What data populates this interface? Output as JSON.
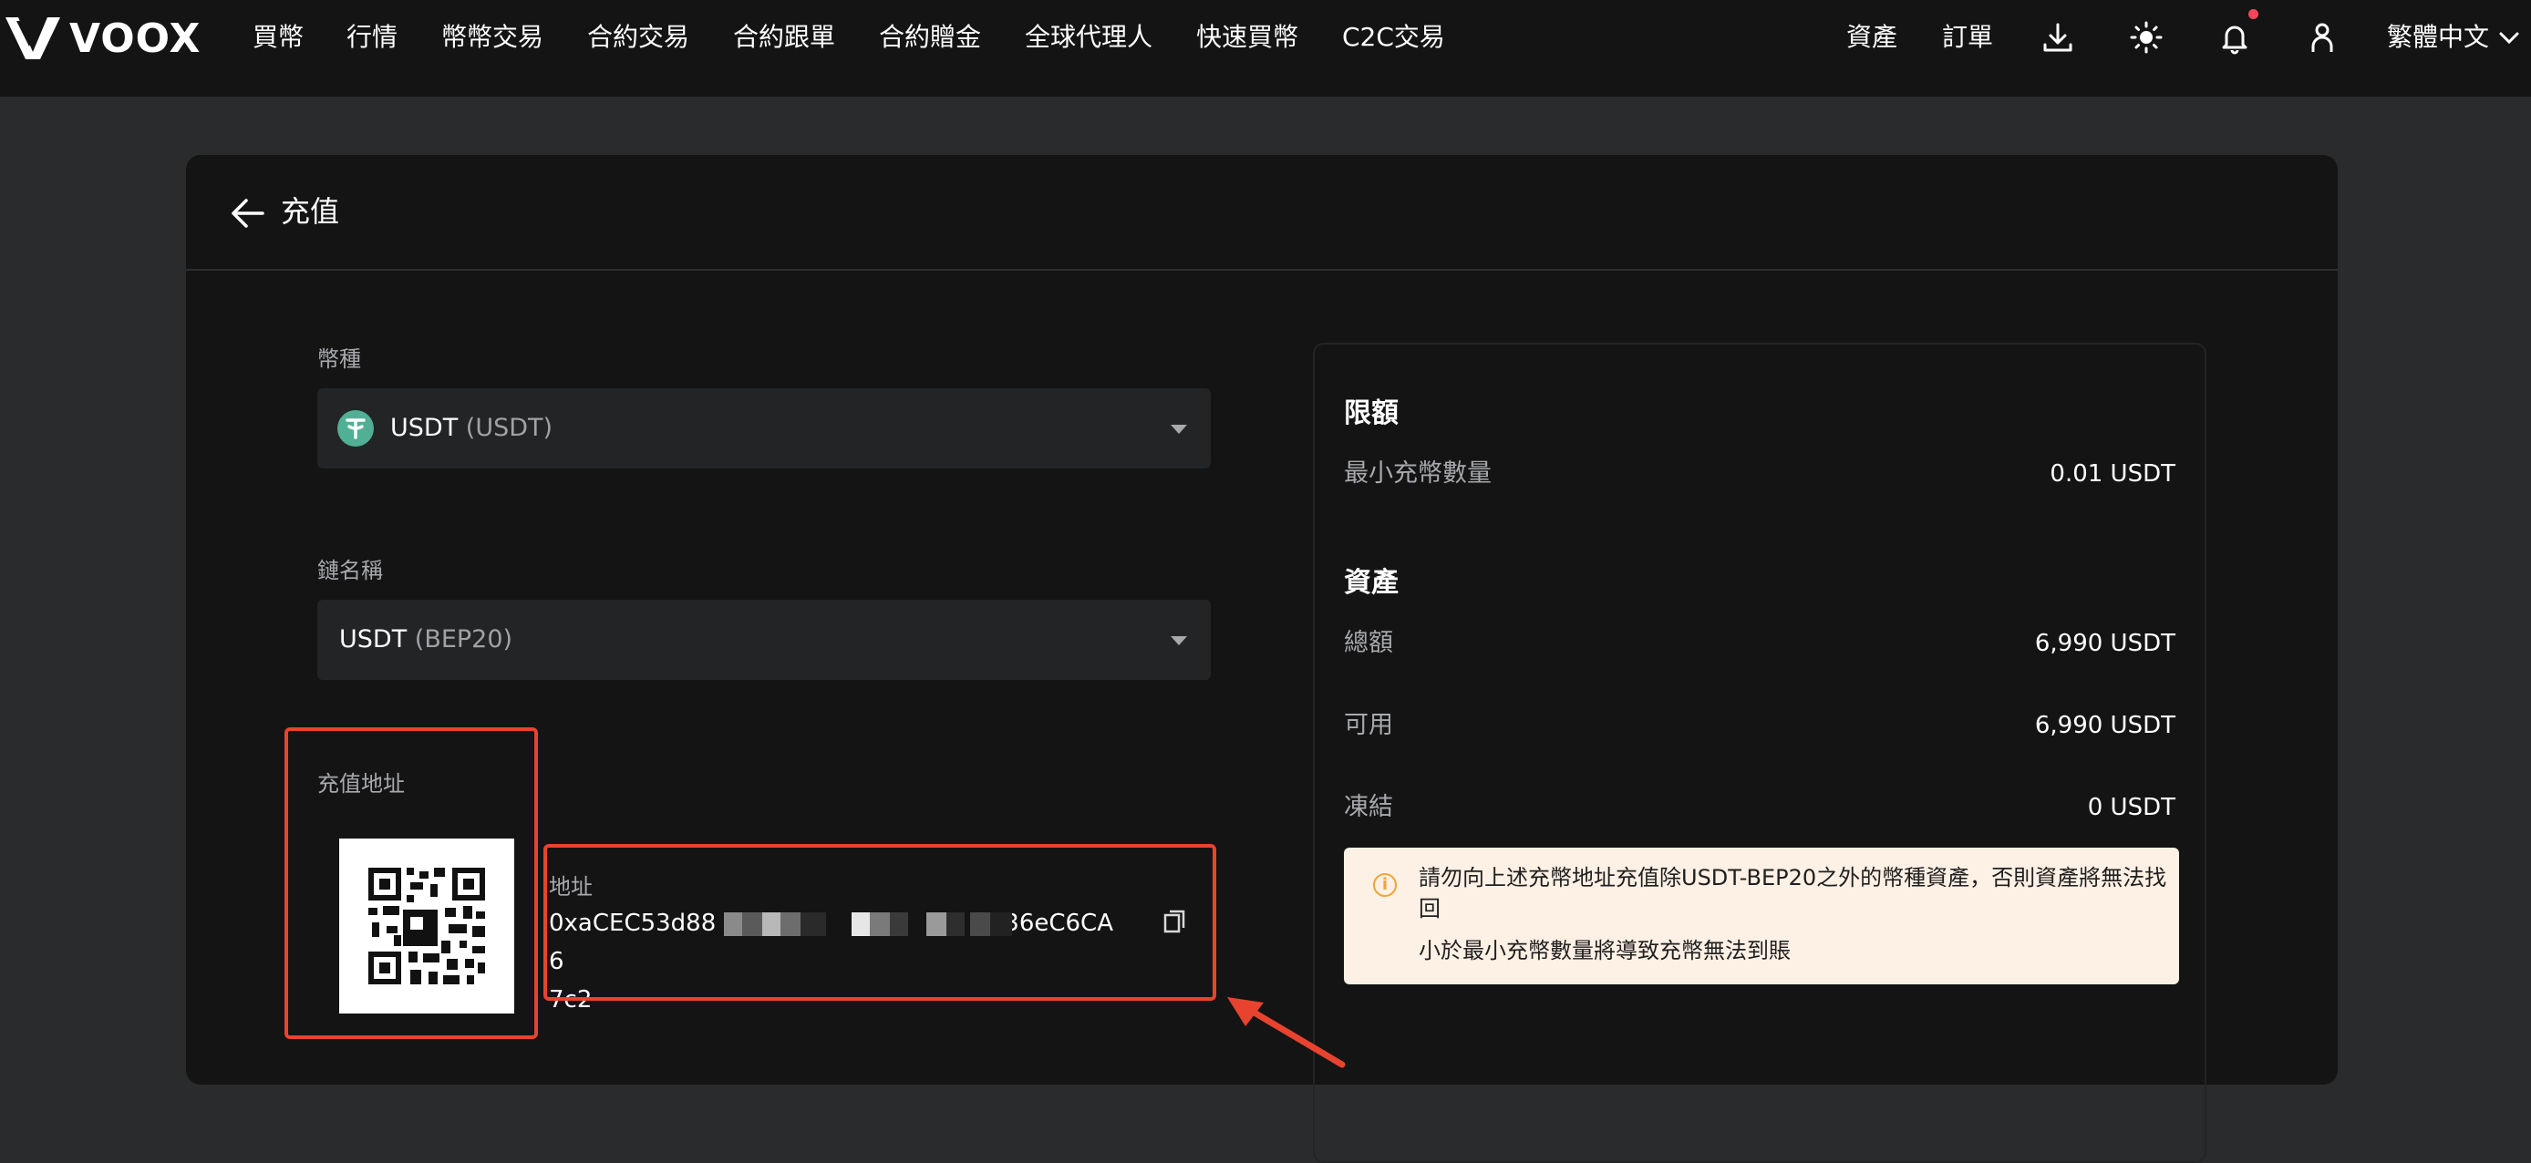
{
  "brand": {
    "logo_text": "VOOX"
  },
  "nav": {
    "items": [
      "買幣",
      "行情",
      "幣幣交易",
      "合約交易",
      "合約跟單",
      "合約贈金",
      "全球代理人",
      "快速買幣",
      "C2C交易"
    ],
    "right": {
      "assets": "資產",
      "orders": "訂單",
      "language": "繁體中文"
    },
    "icons": [
      "download-icon",
      "theme-sun-icon",
      "bell-icon",
      "user-icon",
      "chevron-down-icon"
    ]
  },
  "page": {
    "title": "充值",
    "currency": {
      "label": "幣種",
      "symbol": "USDT",
      "name": "(USDT)",
      "icon": "tether-icon"
    },
    "chain": {
      "label": "鏈名稱",
      "symbol": "USDT",
      "network": "(BEP20)"
    },
    "deposit": {
      "label": "充值地址",
      "address_label": "地址",
      "address_start": "0xaCEC53d88",
      "address_end": "36eC6CA6",
      "address_last": "7c2"
    }
  },
  "panel": {
    "limits": {
      "heading": "限額",
      "min_label": "最小充幣數量",
      "min_value": "0.01 USDT"
    },
    "assets": {
      "heading": "資產",
      "rows": [
        {
          "label": "總額",
          "value": "6,990 USDT"
        },
        {
          "label": "可用",
          "value": "6,990 USDT"
        },
        {
          "label": "凍結",
          "value": "0 USDT"
        }
      ]
    },
    "warning": {
      "line1": "請勿向上述充幣地址充值除USDT-BEP20之外的幣種資產，否則資產將無法找",
      "line1b": "回",
      "line2": "小於最小充幣數量將導致充幣無法到賬"
    }
  },
  "colors": {
    "accent_red": "#e8432f",
    "tether": "#50af95",
    "warn_bg": "#fdf0e4",
    "warn_icon": "#f0a43a"
  }
}
